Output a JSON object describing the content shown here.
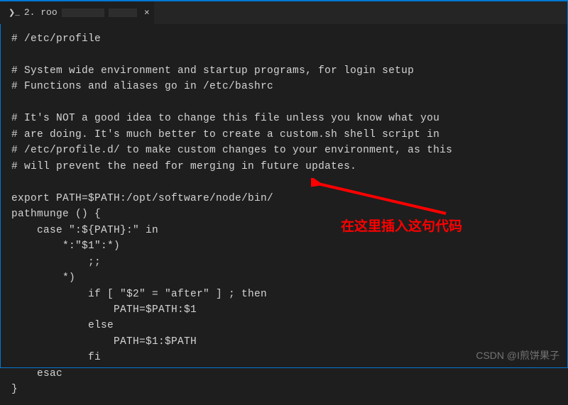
{
  "tab": {
    "prompt_icon": "❯_",
    "label_prefix": "2. roo",
    "close_glyph": "×"
  },
  "terminal": {
    "lines": [
      "# /etc/profile",
      "",
      "# System wide environment and startup programs, for login setup",
      "# Functions and aliases go in /etc/bashrc",
      "",
      "# It's NOT a good idea to change this file unless you know what you",
      "# are doing. It's much better to create a custom.sh shell script in",
      "# /etc/profile.d/ to make custom changes to your environment, as this",
      "# will prevent the need for merging in future updates.",
      "",
      "export PATH=$PATH:/opt/software/node/bin/",
      "pathmunge () {",
      "    case \":${PATH}:\" in",
      "        *:\"$1\":*)",
      "            ;;",
      "        *)",
      "            if [ \"$2\" = \"after\" ] ; then",
      "                PATH=$PATH:$1",
      "            else",
      "                PATH=$1:$PATH",
      "            fi",
      "    esac",
      "}"
    ]
  },
  "annotation": {
    "text": "在这里插入这句代码"
  },
  "watermark": {
    "text": "CSDN @I煎饼果子"
  }
}
